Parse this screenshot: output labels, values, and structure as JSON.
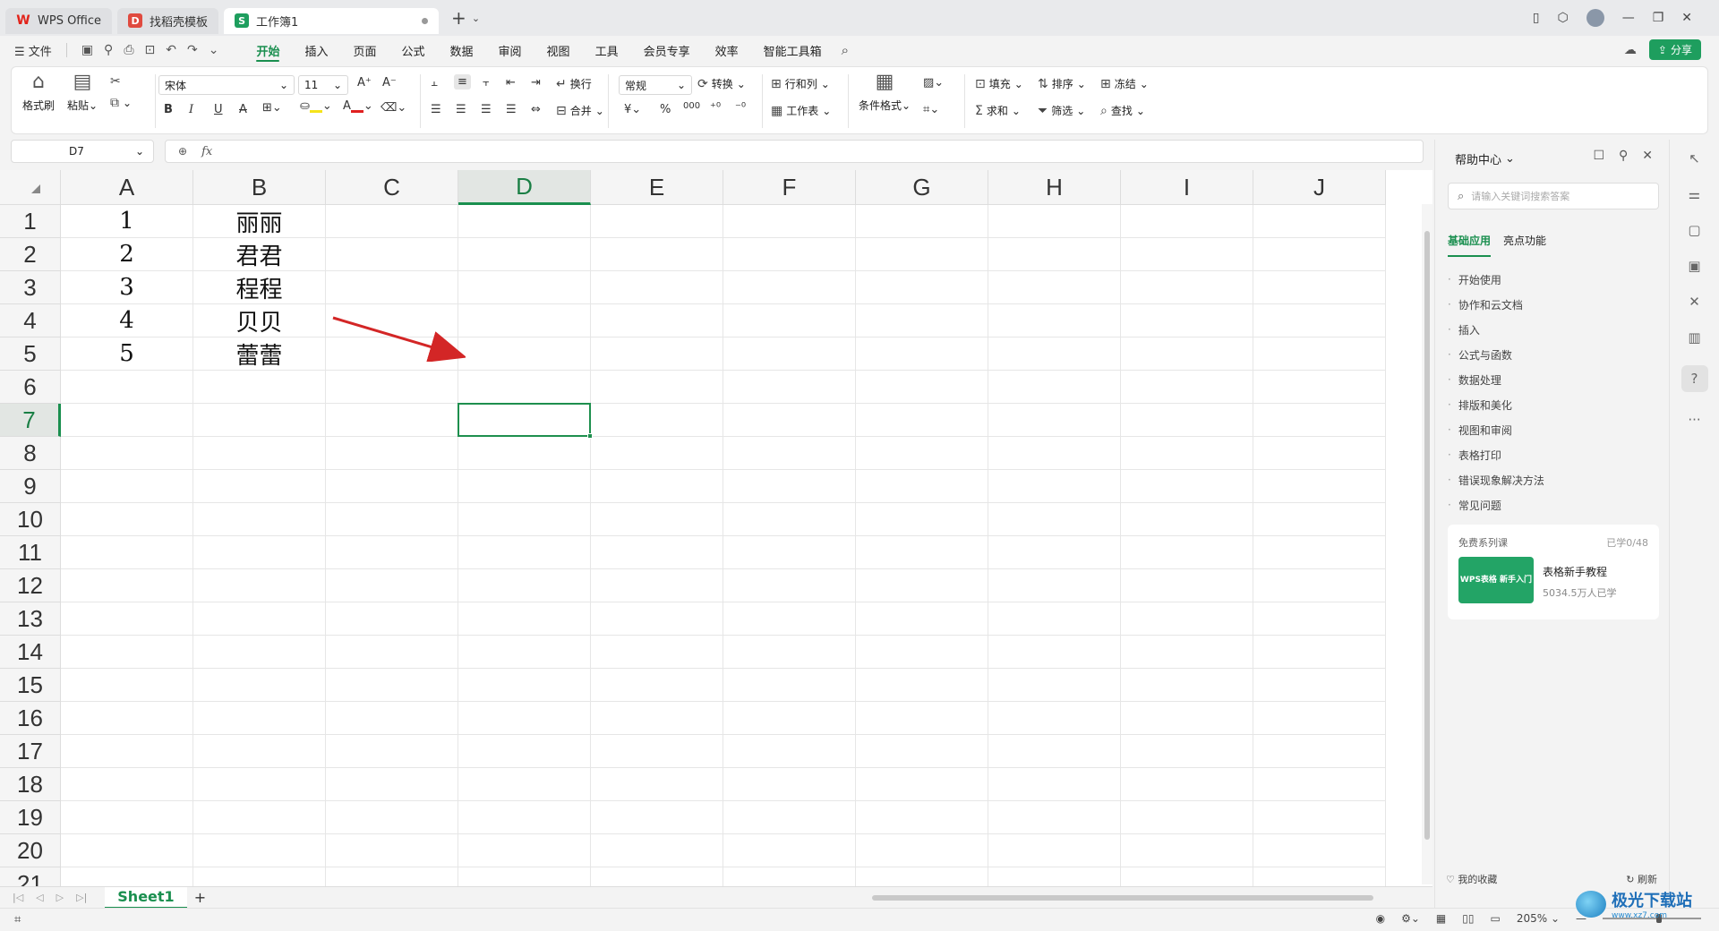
{
  "tabs": [
    {
      "label": "WPS Office",
      "icon": "wps-logo-icon"
    },
    {
      "label": "找稻壳模板",
      "icon": "docer-icon"
    },
    {
      "label": "工作簿1",
      "icon": "sheet-icon",
      "active": true
    }
  ],
  "menubar": {
    "file": "文件",
    "items": [
      "开始",
      "插入",
      "页面",
      "公式",
      "数据",
      "审阅",
      "视图",
      "工具",
      "会员专享",
      "效率",
      "智能工具箱"
    ],
    "active": "开始",
    "share": "分享"
  },
  "ribbon": {
    "format_painter": "格式刷",
    "paste": "粘贴",
    "font_name": "宋体",
    "font_size": "11",
    "wrap": "换行",
    "merge": "合并",
    "number_format": "常规",
    "convert": "转换",
    "rows_cols": "行和列",
    "worksheet": "工作表",
    "cond_format": "条件格式",
    "fill": "填充",
    "sort": "排序",
    "freeze": "冻结",
    "sum": "求和",
    "filter": "筛选",
    "find": "查找",
    "bold": "B",
    "italic": "I",
    "underline": "U",
    "strike": "A",
    "percent": "%",
    "thousands": "000",
    "currency": "¥",
    "accent_color": "#1a8f4f",
    "font_color": "#e02020",
    "highlight_color": "#f5e31a"
  },
  "formula_bar": {
    "name_box": "D7",
    "fx": "fx",
    "value": ""
  },
  "grid": {
    "columns": [
      "A",
      "B",
      "C",
      "D",
      "E",
      "F",
      "G",
      "H",
      "I",
      "J"
    ],
    "rows": [
      "1",
      "2",
      "3",
      "4",
      "5",
      "6",
      "7",
      "8",
      "9",
      "10",
      "11",
      "12",
      "13",
      "14",
      "15",
      "16",
      "17",
      "18",
      "19",
      "20",
      "21"
    ],
    "active_cell": "D7",
    "cells": {
      "A": [
        "1",
        "2",
        "3",
        "4",
        "5"
      ],
      "B": [
        "丽丽",
        "君君",
        "程程",
        "贝贝",
        "蕾蕾"
      ]
    }
  },
  "sheets": {
    "tabs": [
      "Sheet1"
    ],
    "add": "+"
  },
  "status": {
    "zoom": "205%"
  },
  "help": {
    "title": "帮助中心",
    "search_placeholder": "请输入关键词搜索答案",
    "tabs": [
      "基础应用",
      "亮点功能"
    ],
    "items": [
      "开始使用",
      "协作和云文档",
      "插入",
      "公式与函数",
      "数据处理",
      "排版和美化",
      "视图和审阅",
      "表格打印",
      "错误现象解决方法",
      "常见问题"
    ],
    "card": {
      "header": "免费系列课",
      "progress": "已学0/48",
      "thumb_text": "WPS表格 新手入门",
      "title": "表格新手教程",
      "meta": "5034.5万人已学"
    },
    "favorites": "我的收藏",
    "refresh": "刷新"
  },
  "watermark": {
    "main": "极光下载站",
    "sub": "www.xz7.com"
  }
}
